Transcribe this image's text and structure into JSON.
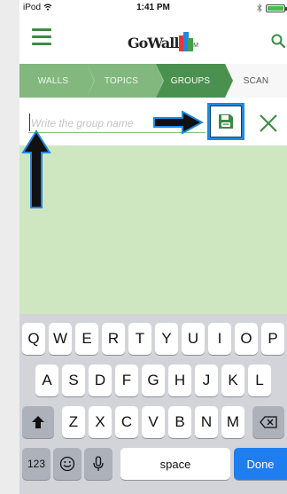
{
  "status_bar": {
    "carrier": "iPod",
    "time": "1:41 PM"
  },
  "app": {
    "logo_text": "GoWall",
    "logo_tm": "TM"
  },
  "tabs": [
    {
      "label": "WALLS",
      "active": false
    },
    {
      "label": "TOPICS",
      "active": false
    },
    {
      "label": "GROUPS",
      "active": true
    },
    {
      "label": "SCAN",
      "active": false
    }
  ],
  "group_form": {
    "input_placeholder": "Write the group name",
    "input_value": ""
  },
  "icons": {
    "menu": "hamburger-icon",
    "search": "search-icon",
    "save": "floppy-disk-icon",
    "close": "close-icon",
    "wifi": "wifi-icon",
    "bluetooth": "bluetooth-icon",
    "battery": "battery-icon"
  },
  "colors": {
    "brand_green": "#3c8b44",
    "tab_bar": "#82b87d",
    "tab_active": "#4a9150",
    "content_area": "#cfe7c0",
    "highlight_blue": "#1e88e5"
  },
  "keyboard": {
    "row1": [
      "Q",
      "W",
      "E",
      "R",
      "T",
      "Y",
      "U",
      "I",
      "O",
      "P"
    ],
    "row2": [
      "A",
      "S",
      "D",
      "F",
      "G",
      "H",
      "J",
      "K",
      "L"
    ],
    "row3": [
      "Z",
      "X",
      "C",
      "V",
      "B",
      "N",
      "M"
    ],
    "numbers_key": "123",
    "space_key": "space",
    "done_key": "Done"
  }
}
